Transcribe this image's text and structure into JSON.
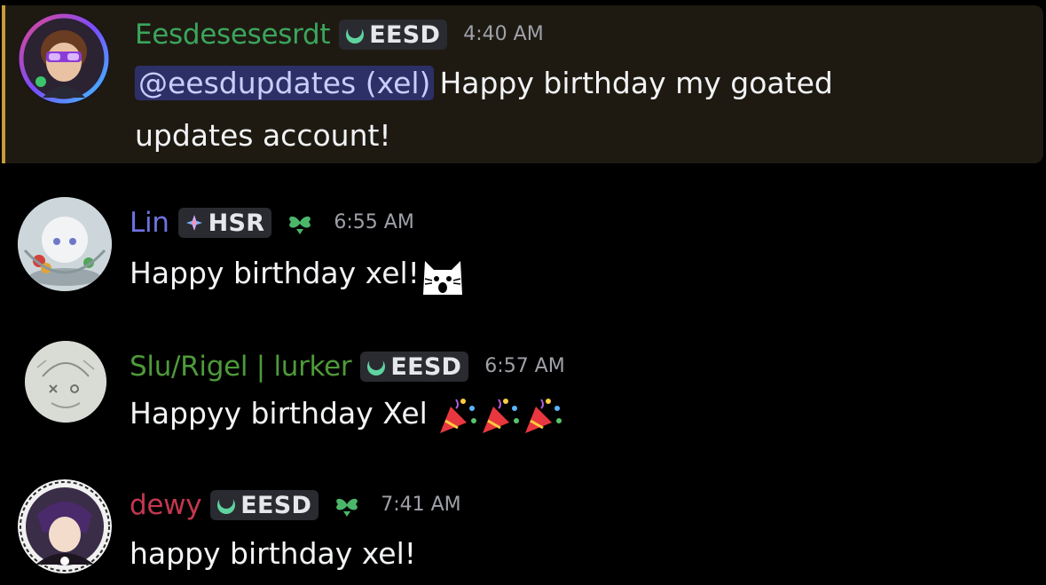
{
  "colors": {
    "background": "#000000",
    "highlight_background": "#1e1a12",
    "highlight_border": "#c79a3c",
    "mention_background": "#2d3066",
    "mention_text": "#c9cdfb",
    "timestamp": "#9fa1a8",
    "message_text": "#f2f3f5"
  },
  "messages": [
    {
      "username": "Eesdesesesrdt",
      "username_color": "#3ba55c",
      "tag": "EESD",
      "tag_icon": "eesd-crescent-icon",
      "timestamp": "4:40 AM",
      "mention": "@eesdupdates (xel)",
      "text_line1": "Happy birthday my goated",
      "text_line2": "updates account!",
      "highlighted": true
    },
    {
      "username": "Lin",
      "username_color": "#6f72e0",
      "tag": "HSR",
      "tag_icon": "hsr-star-icon",
      "decoration_icon": "clover-heart-icon",
      "timestamp": "6:55 AM",
      "text": "Happy birthday xel!",
      "emoji": "screaming-cat-emoji"
    },
    {
      "username": "Slu/Rigel | lurker",
      "username_color": "#4e9a3a",
      "tag": "EESD",
      "tag_icon": "eesd-crescent-icon",
      "timestamp": "6:57 AM",
      "text": "Happyy birthday Xel",
      "emoji": "party-popper-emoji"
    },
    {
      "username": "dewy",
      "username_color": "#c3374f",
      "tag": "EESD",
      "tag_icon": "eesd-crescent-icon",
      "decoration_icon": "clover-heart-icon",
      "timestamp": "7:41 AM",
      "text": "happy birthday xel!"
    }
  ]
}
